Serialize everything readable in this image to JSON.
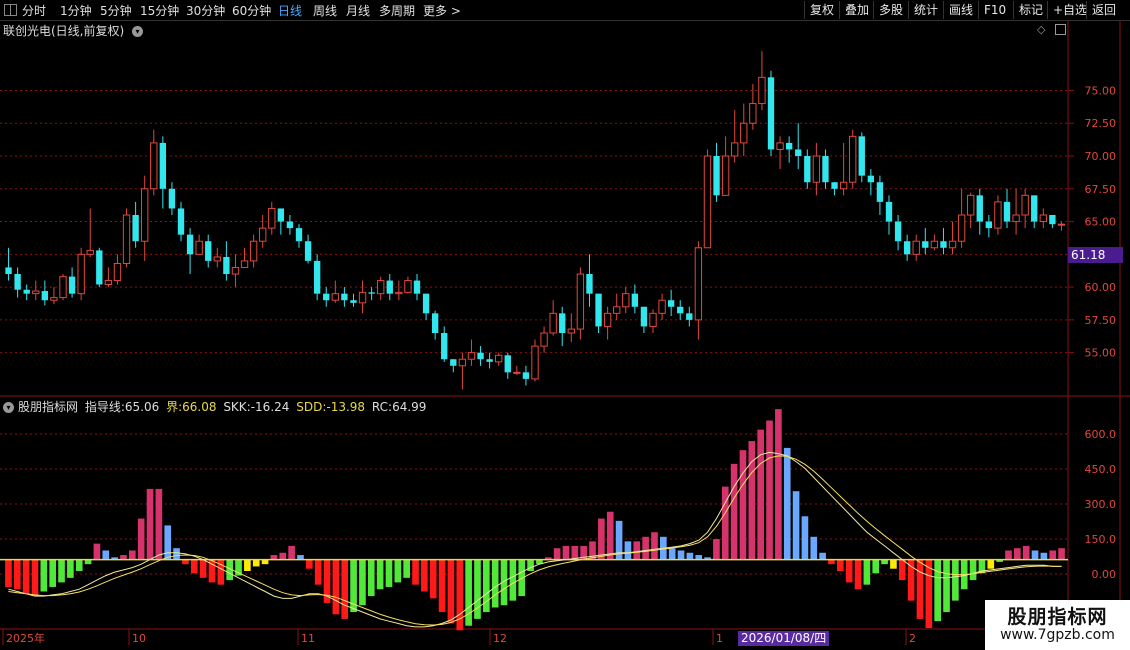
{
  "toolbar": {
    "periods": [
      "分时",
      "1分钟",
      "5分钟",
      "15分钟",
      "30分钟",
      "60分钟",
      "日线",
      "周线",
      "月线",
      "多周期",
      "更多 >"
    ],
    "active_period": "日线",
    "right_buttons": [
      "复权",
      "叠加",
      "多股",
      "统计",
      "画线",
      "F10",
      "标记",
      "+自选",
      "返回"
    ]
  },
  "stock": {
    "title": "联创光电(日线,前复权)",
    "dropdown_icon": "chevron-down-icon"
  },
  "price_axis": {
    "labels": [
      "75.00",
      "72.50",
      "70.00",
      "67.50",
      "65.00",
      "62.50",
      "60.00",
      "57.50",
      "55.00"
    ],
    "current_price": "61.18"
  },
  "indicator": {
    "name": "股朋指标网",
    "fields": [
      {
        "label": "指导线:",
        "value": "65.06",
        "color": "#dddddd"
      },
      {
        "label": "界:",
        "value": "66.08",
        "color": "#e8d84a"
      },
      {
        "label": "SKK:",
        "value": "-16.24",
        "color": "#dddddd"
      },
      {
        "label": "SDD:",
        "value": "-13.98",
        "color": "#e8d84a"
      },
      {
        "label": "RC:",
        "value": "64.99",
        "color": "#dddddd"
      }
    ],
    "axis_labels": [
      "600.0",
      "450.0",
      "300.0",
      "150.0",
      "0.00"
    ]
  },
  "time_axis": {
    "labels": [
      "2025年",
      "10",
      "11",
      "12",
      "1",
      "2"
    ],
    "cursor_date": "2026/01/08/四"
  },
  "watermark": {
    "title": "股朋指标网",
    "url": "www.7gpzb.com"
  },
  "colors": {
    "up": "#e0483c",
    "down": "#32e6ee",
    "grid": "#8b1010",
    "hist_red": "#ff1a1a",
    "hist_pink": "#d6336c",
    "hist_green": "#52e83a",
    "hist_blue": "#6aa8ff",
    "hist_yellow": "#ffea00"
  },
  "chart_data": {
    "type": "candlestick",
    "price_ylim": [
      52.0,
      79.0
    ],
    "candles": [
      [
        61.5,
        61.0,
        63.0,
        60.5
      ],
      [
        61.0,
        59.8,
        61.5,
        59.2
      ],
      [
        59.8,
        59.5,
        60.2,
        59.0
      ],
      [
        59.5,
        59.7,
        60.5,
        59.0
      ],
      [
        59.7,
        59.0,
        60.5,
        58.6
      ],
      [
        59.0,
        59.2,
        60.0,
        58.7
      ],
      [
        59.2,
        60.8,
        61.0,
        59.0
      ],
      [
        60.8,
        59.5,
        61.5,
        59.2
      ],
      [
        59.5,
        62.5,
        63.0,
        59.0
      ],
      [
        62.5,
        62.8,
        66.0,
        62.3
      ],
      [
        62.8,
        60.2,
        63.0,
        60.0
      ],
      [
        60.2,
        60.5,
        61.5,
        60.0
      ],
      [
        60.5,
        61.8,
        62.5,
        60.2
      ],
      [
        61.8,
        65.5,
        66.0,
        61.5
      ],
      [
        65.5,
        63.5,
        66.5,
        63.0
      ],
      [
        63.5,
        67.5,
        68.5,
        62.0
      ],
      [
        67.5,
        71.0,
        72.0,
        67.0
      ],
      [
        71.0,
        67.5,
        71.5,
        66.0
      ],
      [
        67.5,
        66.0,
        68.0,
        65.5
      ],
      [
        66.0,
        64.0,
        66.5,
        63.5
      ],
      [
        64.0,
        62.5,
        64.5,
        61.0
      ],
      [
        62.5,
        63.5,
        64.0,
        62.5
      ],
      [
        63.5,
        62.0,
        64.0,
        61.5
      ],
      [
        62.0,
        62.3,
        63.0,
        61.5
      ],
      [
        62.3,
        61.0,
        63.5,
        60.5
      ],
      [
        61.0,
        61.5,
        62.5,
        60.0
      ],
      [
        61.5,
        62.0,
        63.0,
        61.5
      ],
      [
        62.0,
        63.5,
        64.0,
        61.5
      ],
      [
        63.5,
        64.5,
        65.5,
        63.0
      ],
      [
        64.5,
        66.0,
        66.5,
        64.0
      ],
      [
        66.0,
        65.0,
        66.0,
        64.0
      ],
      [
        65.0,
        64.5,
        65.5,
        64.0
      ],
      [
        64.5,
        63.5,
        64.8,
        63.0
      ],
      [
        63.5,
        62.0,
        64.0,
        61.8
      ],
      [
        62.0,
        59.5,
        62.5,
        59.0
      ],
      [
        59.5,
        59.0,
        60.0,
        58.5
      ],
      [
        59.0,
        59.5,
        60.5,
        58.8
      ],
      [
        59.5,
        59.0,
        60.0,
        58.5
      ],
      [
        59.0,
        58.8,
        59.5,
        58.5
      ],
      [
        58.8,
        59.6,
        60.5,
        58.0
      ],
      [
        59.6,
        59.5,
        60.0,
        59.0
      ],
      [
        59.5,
        60.5,
        60.8,
        59.0
      ],
      [
        60.5,
        59.5,
        61.0,
        59.0
      ],
      [
        59.5,
        59.6,
        60.5,
        59.0
      ],
      [
        59.6,
        60.5,
        60.8,
        59.5
      ],
      [
        60.5,
        59.5,
        61.0,
        59.0
      ],
      [
        59.5,
        58.0,
        59.5,
        57.5
      ],
      [
        58.0,
        56.5,
        58.2,
        56.0
      ],
      [
        56.5,
        54.5,
        57.0,
        54.3
      ],
      [
        54.5,
        54.0,
        54.5,
        53.5
      ],
      [
        54.0,
        54.5,
        55.0,
        52.2
      ],
      [
        54.5,
        55.0,
        56.0,
        54.0
      ],
      [
        55.0,
        54.5,
        55.5,
        54.0
      ],
      [
        54.5,
        54.3,
        55.0,
        53.8
      ],
      [
        54.3,
        54.8,
        55.0,
        54.0
      ],
      [
        54.8,
        53.5,
        55.0,
        53.0
      ],
      [
        53.5,
        53.5,
        54.0,
        53.3
      ],
      [
        53.5,
        53.0,
        54.0,
        52.5
      ],
      [
        53.0,
        55.5,
        56.0,
        52.8
      ],
      [
        55.5,
        56.5,
        57.0,
        55.0
      ],
      [
        56.5,
        58.0,
        59.0,
        56.3
      ],
      [
        58.0,
        56.5,
        58.5,
        55.5
      ],
      [
        56.5,
        56.8,
        58.0,
        55.8
      ],
      [
        56.8,
        61.0,
        61.5,
        56.0
      ],
      [
        61.0,
        59.5,
        62.5,
        58.5
      ],
      [
        59.5,
        57.0,
        59.5,
        56.5
      ],
      [
        57.0,
        58.0,
        58.5,
        56.0
      ],
      [
        58.0,
        58.5,
        59.5,
        57.5
      ],
      [
        58.5,
        59.5,
        60.0,
        58.0
      ],
      [
        59.5,
        58.5,
        60.2,
        58.0
      ],
      [
        58.5,
        57.0,
        58.5,
        56.5
      ],
      [
        57.0,
        58.0,
        58.3,
        56.5
      ],
      [
        58.0,
        59.0,
        59.5,
        57.5
      ],
      [
        59.0,
        58.5,
        59.8,
        57.8
      ],
      [
        58.5,
        58.0,
        59.0,
        57.5
      ],
      [
        58.0,
        57.5,
        58.5,
        57.0
      ],
      [
        57.5,
        63.0,
        63.5,
        56.0
      ],
      [
        63.0,
        70.0,
        70.5,
        64.5
      ],
      [
        70.0,
        67.0,
        71.0,
        66.5
      ],
      [
        67.0,
        70.0,
        71.5,
        67.0
      ],
      [
        70.0,
        71.0,
        73.5,
        69.5
      ],
      [
        71.0,
        72.5,
        74.0,
        70.0
      ],
      [
        72.5,
        74.0,
        75.5,
        72.0
      ],
      [
        74.0,
        76.0,
        78.0,
        73.5
      ],
      [
        76.0,
        70.5,
        76.5,
        70.0
      ],
      [
        70.5,
        71.0,
        71.5,
        69.0
      ],
      [
        71.0,
        70.5,
        71.5,
        69.5
      ],
      [
        70.5,
        70.0,
        72.5,
        69.0
      ],
      [
        70.0,
        68.0,
        70.5,
        67.5
      ],
      [
        68.0,
        70.0,
        71.0,
        67.0
      ],
      [
        70.0,
        68.0,
        70.5,
        67.5
      ],
      [
        68.0,
        67.5,
        68.0,
        67.0
      ],
      [
        67.5,
        68.0,
        71.0,
        67.0
      ],
      [
        68.0,
        71.5,
        72.0,
        67.5
      ],
      [
        71.5,
        68.5,
        71.8,
        68.0
      ],
      [
        68.5,
        68.0,
        69.0,
        67.0
      ],
      [
        68.0,
        66.5,
        68.5,
        65.5
      ],
      [
        66.5,
        65.0,
        67.0,
        64.0
      ],
      [
        65.0,
        63.5,
        65.5,
        62.8
      ],
      [
        63.5,
        62.5,
        64.0,
        62.0
      ],
      [
        62.5,
        63.5,
        64.0,
        62.0
      ],
      [
        63.5,
        63.0,
        64.5,
        62.5
      ],
      [
        63.0,
        63.5,
        64.0,
        62.8
      ],
      [
        63.5,
        63.0,
        64.5,
        62.5
      ],
      [
        63.0,
        63.5,
        65.0,
        62.5
      ],
      [
        63.5,
        65.5,
        67.5,
        63.0
      ],
      [
        65.5,
        67.0,
        67.2,
        64.5
      ],
      [
        67.0,
        65.0,
        67.5,
        64.0
      ],
      [
        65.0,
        64.5,
        65.5,
        63.8
      ],
      [
        64.5,
        66.5,
        67.0,
        64.0
      ],
      [
        66.5,
        65.0,
        67.5,
        64.5
      ],
      [
        65.0,
        65.5,
        67.5,
        64.0
      ],
      [
        65.5,
        67.0,
        67.5,
        64.5
      ],
      [
        67.0,
        65.0,
        67.0,
        64.5
      ],
      [
        65.0,
        65.5,
        66.0,
        64.5
      ],
      [
        65.5,
        64.8,
        65.5,
        64.5
      ],
      [
        64.8,
        64.8,
        65.0,
        64.3
      ]
    ],
    "indicator_ylim": [
      -300,
      700
    ],
    "histogram": [
      -120,
      -130,
      -150,
      -160,
      -140,
      -120,
      -100,
      -80,
      -50,
      -20,
      70,
      40,
      10,
      20,
      40,
      180,
      310,
      310,
      150,
      50,
      -20,
      -60,
      -80,
      -100,
      -110,
      -90,
      -70,
      -50,
      -30,
      -20,
      20,
      30,
      60,
      20,
      -40,
      -110,
      -190,
      -240,
      -260,
      -230,
      -200,
      -160,
      -130,
      -120,
      -100,
      -80,
      -110,
      -140,
      -170,
      -230,
      -280,
      -310,
      -290,
      -260,
      -230,
      -210,
      -200,
      -180,
      -160,
      -50,
      -20,
      10,
      50,
      60,
      60,
      60,
      80,
      180,
      210,
      170,
      80,
      80,
      100,
      120,
      100,
      50,
      40,
      30,
      20,
      10,
      90,
      320,
      420,
      480,
      520,
      570,
      610,
      660,
      490,
      300,
      190,
      100,
      30,
      -20,
      -50,
      -100,
      -130,
      -110,
      -60,
      -20,
      -40,
      -90,
      -180,
      -260,
      -300,
      -270,
      -230,
      -180,
      -130,
      -90,
      -60,
      -40,
      -10,
      40,
      50,
      60,
      40,
      30,
      40,
      50
    ],
    "series": [
      {
        "name": "SKK",
        "values": [
          -130,
          -140,
          -150,
          -160,
          -160,
          -155,
          -150,
          -140,
          -130,
          -110,
          -90,
          -70,
          -55,
          -45,
          -35,
          -20,
          0,
          20,
          30,
          30,
          25,
          15,
          0,
          -20,
          -40,
          -60,
          -80,
          -100,
          -120,
          -140,
          -160,
          -170,
          -170,
          -160,
          -150,
          -150,
          -160,
          -180,
          -200,
          -215,
          -230,
          -245,
          -260,
          -270,
          -280,
          -290,
          -295,
          -295,
          -290,
          -280,
          -265,
          -240,
          -210,
          -180,
          -150,
          -120,
          -95,
          -75,
          -55,
          -35,
          -20,
          -10,
          -5,
          0,
          5,
          10,
          15,
          20,
          25,
          30,
          30,
          35,
          40,
          45,
          50,
          55,
          60,
          70,
          85,
          120,
          180,
          250,
          320,
          380,
          430,
          460,
          470,
          465,
          455,
          430,
          400,
          360,
          320,
          280,
          240,
          200,
          160,
          120,
          90,
          60,
          30,
          0,
          -30,
          -55,
          -70,
          -80,
          -80,
          -75,
          -70,
          -60,
          -50,
          -45,
          -40,
          -35,
          -30,
          -25,
          -25,
          -25,
          -30,
          -30
        ]
      },
      {
        "name": "SDD",
        "values": [
          -140,
          -145,
          -150,
          -155,
          -158,
          -158,
          -155,
          -150,
          -142,
          -130,
          -115,
          -98,
          -82,
          -68,
          -55,
          -40,
          -22,
          -5,
          10,
          18,
          20,
          18,
          10,
          -5,
          -22,
          -40,
          -58,
          -76,
          -94,
          -112,
          -130,
          -145,
          -155,
          -158,
          -155,
          -153,
          -156,
          -165,
          -180,
          -195,
          -210,
          -225,
          -240,
          -252,
          -263,
          -273,
          -281,
          -286,
          -287,
          -284,
          -276,
          -260,
          -238,
          -212,
          -184,
          -155,
          -128,
          -104,
          -82,
          -62,
          -45,
          -32,
          -22,
          -14,
          -6,
          2,
          8,
          14,
          20,
          25,
          28,
          32,
          36,
          41,
          46,
          51,
          56,
          63,
          74,
          100,
          145,
          205,
          270,
          330,
          382,
          422,
          446,
          455,
          453,
          440,
          418,
          388,
          352,
          315,
          277,
          240,
          203,
          168,
          136,
          105,
          75,
          45,
          15,
          -12,
          -35,
          -52,
          -62,
          -66,
          -66,
          -62,
          -56,
          -51,
          -46,
          -41,
          -36,
          -31,
          -29,
          -28,
          -29,
          -30
        ]
      }
    ]
  }
}
